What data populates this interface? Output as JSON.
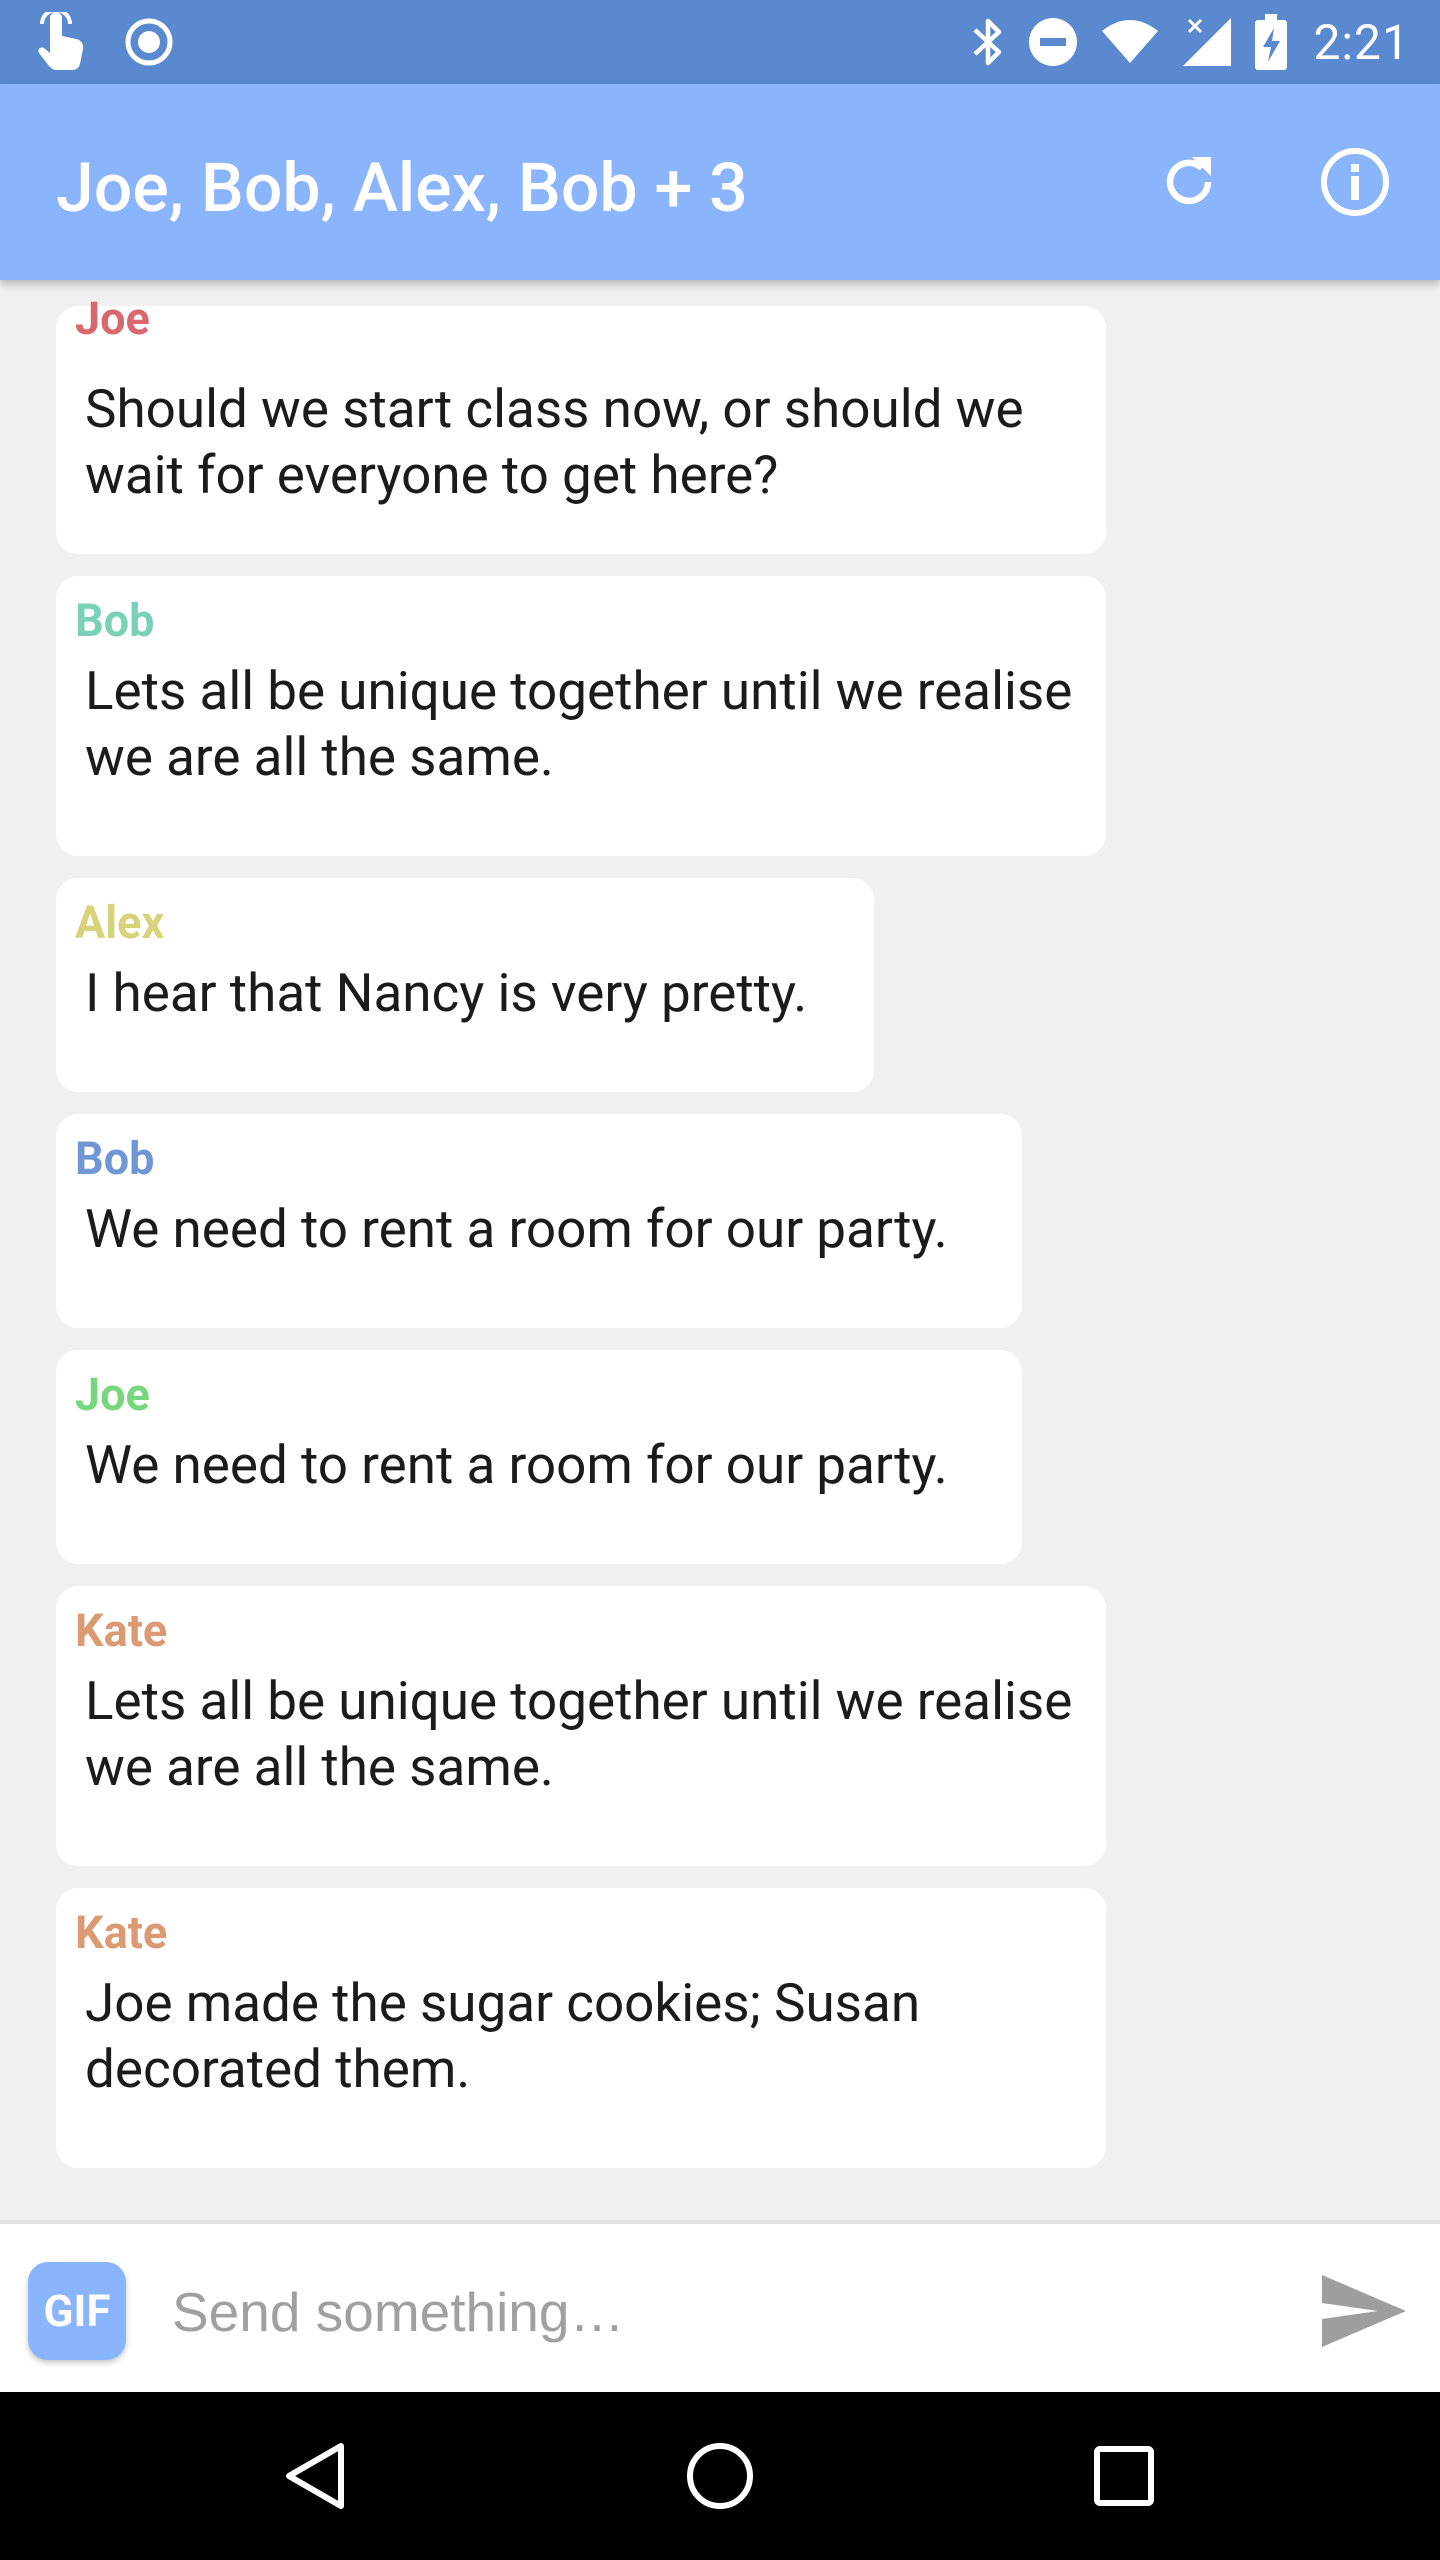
{
  "status_bar": {
    "time": "2:21",
    "left_icons": [
      "touch-icon",
      "record-icon"
    ],
    "right_icons": [
      "bluetooth-icon",
      "do-not-disturb-icon",
      "wifi-icon",
      "cell-signal-icon",
      "battery-charging-icon"
    ]
  },
  "app_bar": {
    "title": "Joe, Bob, Alex, Bob + 3",
    "actions": [
      "refresh-icon",
      "info-icon"
    ],
    "color": "#8ab4fb"
  },
  "messages": [
    {
      "sender": "Joe",
      "sender_color": "#d9686e",
      "text": "Should we start class now, or should we wait for everyone to get here?"
    },
    {
      "sender": "Bob",
      "sender_color": "#79d2b8",
      "text": "Lets all be unique together until we realise we are all the same."
    },
    {
      "sender": "Alex",
      "sender_color": "#d8d27a",
      "text": "I hear that Nancy is very pretty."
    },
    {
      "sender": "Bob",
      "sender_color": "#6f97d6",
      "text": "We need to rent a room for our party."
    },
    {
      "sender": "Joe",
      "sender_color": "#76d77d",
      "text": "We need to rent a room for our party."
    },
    {
      "sender": "Kate",
      "sender_color": "#db9a72",
      "text": "Lets all be unique together until we realise we are all the same."
    },
    {
      "sender": "Kate",
      "sender_color": "#db9a72",
      "text": "Joe made the sugar cookies; Susan decorated them."
    }
  ],
  "composer": {
    "gif_label": "GIF",
    "placeholder": "Send something…",
    "value": "",
    "send_icon": "send-icon"
  },
  "nav_bar": {
    "buttons": [
      "back-icon",
      "home-icon",
      "recents-icon"
    ]
  }
}
